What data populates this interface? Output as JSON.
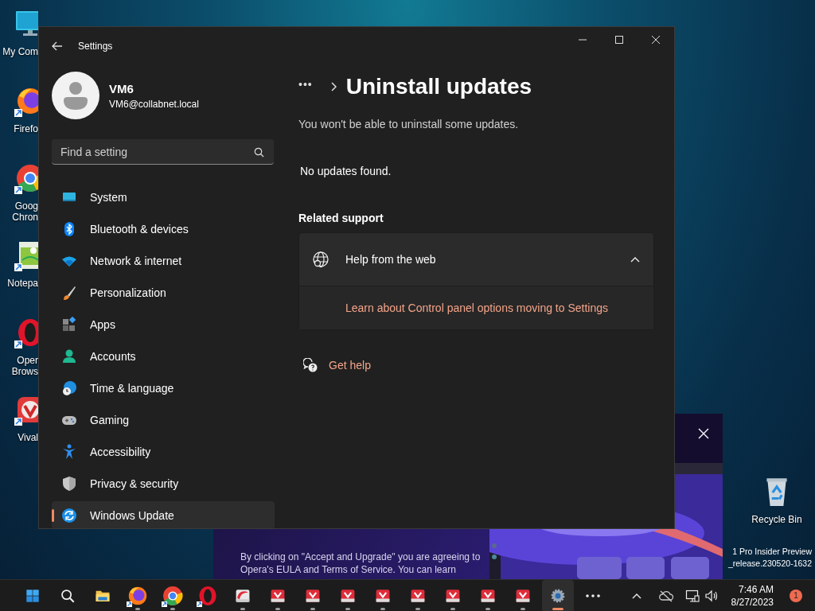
{
  "desktop": {
    "icons": [
      {
        "kind": "computer",
        "label": "My Com"
      },
      {
        "kind": "firefox",
        "label": "Firefo"
      },
      {
        "kind": "chrome",
        "label": "Goog\nChron"
      },
      {
        "kind": "notepad",
        "label": "Notepa"
      },
      {
        "kind": "opera",
        "label": "Oper\nBrows"
      },
      {
        "kind": "vivaldi",
        "label": "Vival"
      }
    ],
    "recycle_bin": {
      "label": "Recycle Bin"
    },
    "build_info": [
      "1 Pro Insider Preview",
      "_release.230520-1632"
    ]
  },
  "opera_popup": {
    "kind": "picture",
    "text": "By clicking on \"Accept and Upgrade\" you are agreeing to Opera's EULA and Terms of Service. You can learn"
  },
  "settings_window": {
    "title": "Settings",
    "account": {
      "name": "VM6",
      "email": "VM6@collabnet.local"
    },
    "search": {
      "placeholder": "Find a setting"
    },
    "nav": [
      {
        "kind": "system",
        "label": "System",
        "selected": false
      },
      {
        "kind": "bluetooth",
        "label": "Bluetooth & devices",
        "selected": false
      },
      {
        "kind": "network",
        "label": "Network & internet",
        "selected": false
      },
      {
        "kind": "personalization",
        "label": "Personalization",
        "selected": false
      },
      {
        "kind": "apps",
        "label": "Apps",
        "selected": false
      },
      {
        "kind": "accounts",
        "label": "Accounts",
        "selected": false
      },
      {
        "kind": "time",
        "label": "Time & language",
        "selected": false
      },
      {
        "kind": "gaming",
        "label": "Gaming",
        "selected": false
      },
      {
        "kind": "accessibility",
        "label": "Accessibility",
        "selected": false
      },
      {
        "kind": "privacy",
        "label": "Privacy & security",
        "selected": false
      },
      {
        "kind": "update",
        "label": "Windows Update",
        "selected": true
      }
    ],
    "breadcrumb": {
      "more": "•••",
      "title": "Uninstall updates"
    },
    "note": "You won't be able to uninstall some updates.",
    "empty_message": "No updates found.",
    "related": {
      "heading": "Related support",
      "expander": {
        "title": "Help from the web",
        "expanded": true,
        "links": [
          "Learn about Control panel options moving to Settings"
        ]
      }
    },
    "get_help": "Get help"
  },
  "taskbar": {
    "apps": [
      {
        "kind": "start",
        "running": false,
        "selected": false
      },
      {
        "kind": "search",
        "running": false,
        "selected": false
      },
      {
        "kind": "folder",
        "running": false,
        "selected": false
      },
      {
        "kind": "firefox",
        "running": true,
        "selected": false
      },
      {
        "kind": "chrome",
        "running": true,
        "selected": false
      },
      {
        "kind": "opera",
        "running": false,
        "selected": false
      },
      {
        "kind": "app",
        "running": true,
        "selected": false
      },
      {
        "kind": "vivaldi",
        "running": true,
        "selected": false
      },
      {
        "kind": "vivaldi",
        "running": true,
        "selected": false
      },
      {
        "kind": "vivaldi",
        "running": true,
        "selected": false
      },
      {
        "kind": "vivaldi",
        "running": true,
        "selected": false
      },
      {
        "kind": "vivaldi",
        "running": true,
        "selected": false
      },
      {
        "kind": "vivaldi",
        "running": true,
        "selected": false
      },
      {
        "kind": "vivaldi",
        "running": true,
        "selected": false
      },
      {
        "kind": "vivaldi",
        "running": true,
        "selected": false
      },
      {
        "kind": "settings",
        "running": true,
        "selected": true
      },
      {
        "kind": "more",
        "running": false,
        "selected": false
      }
    ],
    "clock": {
      "time": "7:46 AM",
      "date": "8/27/2023"
    },
    "notifications": "1"
  }
}
